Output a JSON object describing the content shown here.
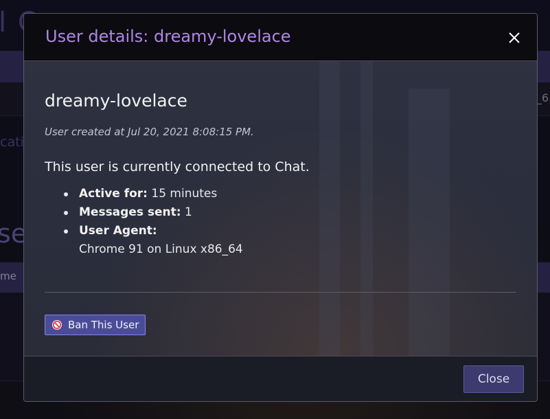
{
  "background": {
    "title_fragment": "l C",
    "subbar_fragment": "_6",
    "link_fragment": "catio",
    "heading_fragment": "ser",
    "table_column_fragment": "me"
  },
  "modal": {
    "title": "User details: dreamy-lovelace",
    "close_icon": "close-icon",
    "username": "dreamy-lovelace",
    "created_text": "User created at Jul 20, 2021 8:08:15 PM.",
    "connected_text": "This user is currently connected to Chat.",
    "details": [
      {
        "label": "Active for:",
        "value": "15 minutes"
      },
      {
        "label": "Messages sent:",
        "value": "1"
      },
      {
        "label": "User Agent:",
        "value": "Chrome 91 on Linux x86_64"
      }
    ],
    "ban_button": {
      "label": "Ban This User",
      "icon": "ban-icon"
    },
    "close_button": "Close"
  },
  "colors": {
    "title": "#b086e6",
    "button_primary": "#4a4c9a",
    "close_button": "#3c3a6e",
    "ban_icon": "#e84a5f"
  }
}
